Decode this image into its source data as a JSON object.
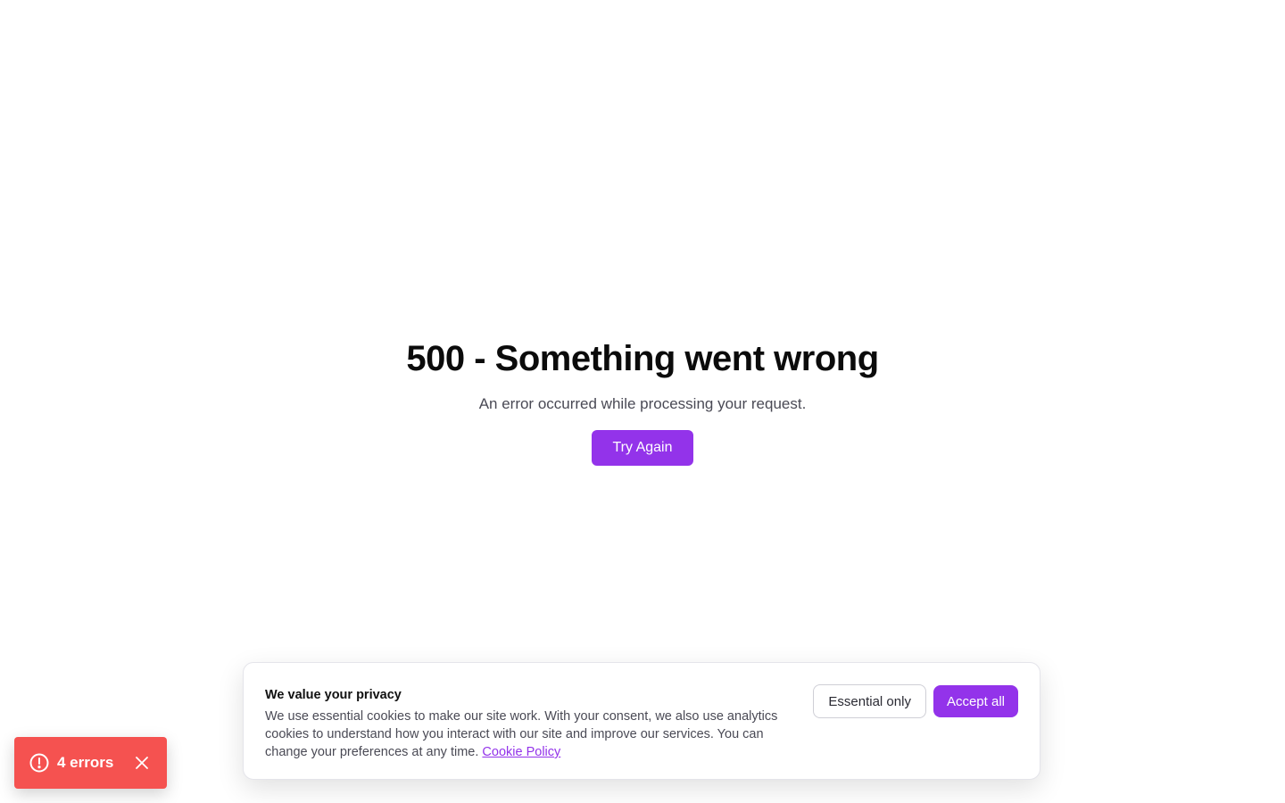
{
  "colors": {
    "accent": "#9333EA",
    "error_toast": "#F55250",
    "link": "#9333EA"
  },
  "error": {
    "title": "500 - Something went wrong",
    "subtitle": "An error occurred while processing your request.",
    "retry_label": "Try Again"
  },
  "cookie_banner": {
    "title": "We value your privacy",
    "body": "We use essential cookies to make our site work. With your consent, we also use analytics cookies to understand how you interact with our site and improve our services. You can change your preferences at any time.",
    "policy_link": "Cookie Policy",
    "essential_label": "Essential only",
    "accept_label": "Accept all"
  },
  "toast": {
    "label": "4 errors",
    "icon": "alert-circle-icon",
    "close_icon": "close-icon"
  }
}
